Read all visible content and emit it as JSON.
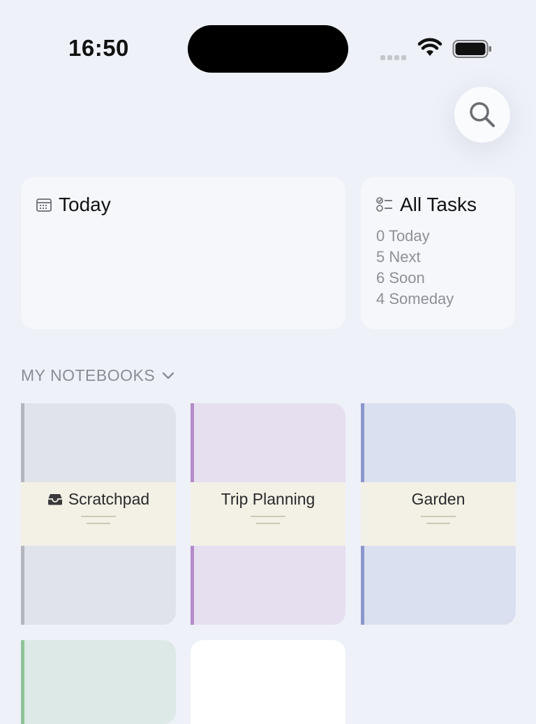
{
  "status_bar": {
    "time": "16:50"
  },
  "today_card": {
    "title": "Today"
  },
  "tasks_card": {
    "title": "All Tasks",
    "items": [
      "0 Today",
      "5 Next",
      "6 Soon",
      "4 Someday"
    ]
  },
  "notebooks_section": {
    "header": "MY NOTEBOOKS"
  },
  "notebooks": [
    {
      "name": "Scratchpad",
      "icon": "inbox-tray-icon",
      "color": "#b3b6bc"
    },
    {
      "name": "Trip Planning",
      "color": "#b48cc8"
    },
    {
      "name": "Garden",
      "color": "#8c96cc"
    },
    {
      "name": "",
      "color": "#8ec49a"
    },
    {
      "name": "",
      "color": "#ffffff"
    }
  ],
  "colors": {
    "background": "#eef1f8",
    "card": "#f5f7fb",
    "label_band": "#f3f0e6"
  }
}
